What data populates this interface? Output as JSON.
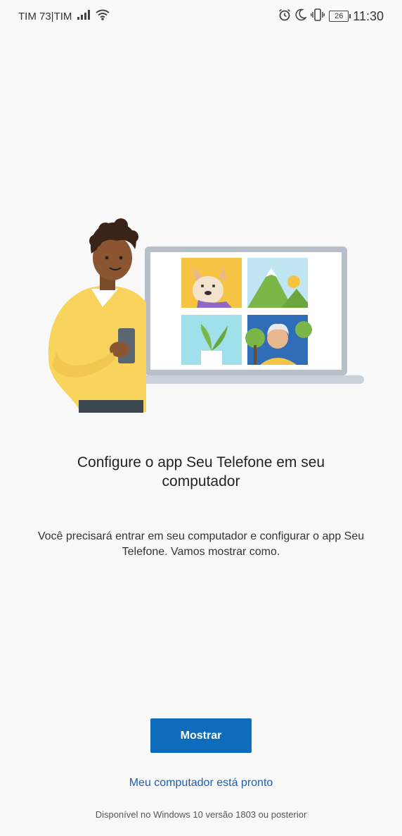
{
  "status_bar": {
    "carrier": "TIM 73|TIM",
    "battery_level": "26",
    "time": "11:30",
    "icons": [
      "signal-icon",
      "wifi-icon",
      "alarm-icon",
      "moon-icon",
      "vibrate-icon",
      "battery-icon"
    ]
  },
  "main": {
    "title": "Configure o app Seu Telefone em seu computador",
    "description": "Você precisará entrar em seu computador e configurar o app Seu Telefone. Vamos mostrar como.",
    "primary_button_label": "Mostrar",
    "secondary_link_label": "Meu computador está pronto",
    "footnote": "Disponível no Windows 10 versão 1803 ou posterior"
  },
  "colors": {
    "background": "#f9f9f9",
    "accent": "#0f6cbd",
    "link": "#1a5fb4"
  }
}
